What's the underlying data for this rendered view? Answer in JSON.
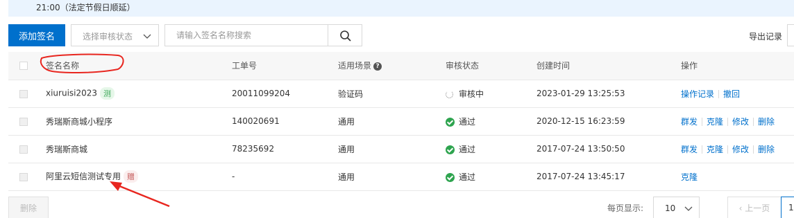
{
  "notice": {
    "text": "21:00（法定节假日顺延）"
  },
  "toolbar": {
    "add_label": "添加签名",
    "status_select_placeholder": "选择审核状态",
    "search_placeholder": "请输入签名名称搜索",
    "export_label": "导出记录"
  },
  "table": {
    "headers": {
      "name": "签名名称",
      "order_no": "工单号",
      "scene": "适用场景",
      "status": "审核状态",
      "created": "创建时间",
      "actions": "操作"
    },
    "rows": [
      {
        "name": "xiuruisi2023",
        "tag": "测",
        "order_no": "20011099204",
        "scene": "验证码",
        "status": "审核中",
        "created": "2023-01-29 13:25:53",
        "actions": [
          "操作记录",
          "撤回"
        ]
      },
      {
        "name": "秀瑞斯商城小程序",
        "tag": "",
        "order_no": "140020691",
        "scene": "通用",
        "status": "通过",
        "created": "2020-12-15 16:23:59",
        "actions": [
          "群发",
          "克隆",
          "修改",
          "删除"
        ]
      },
      {
        "name": "秀瑞斯商城",
        "tag": "",
        "order_no": "78235692",
        "scene": "通用",
        "status": "通过",
        "created": "2017-07-24 13:50:50",
        "actions": [
          "群发",
          "克隆",
          "修改",
          "删除"
        ]
      },
      {
        "name": "阿里云短信测试专用",
        "tag": "赠",
        "order_no": "-",
        "scene": "通用",
        "status": "通过",
        "created": "2017-07-24 13:45:17",
        "actions": [
          "克隆"
        ]
      }
    ]
  },
  "footer": {
    "delete_label": "删除",
    "per_page_label": "每页显示:",
    "per_page_value": "10",
    "prev_label": "上一页",
    "current_page": "1"
  },
  "colors": {
    "primary": "#0070cc",
    "success": "#2ea44f",
    "annotation": "#e8261f"
  }
}
